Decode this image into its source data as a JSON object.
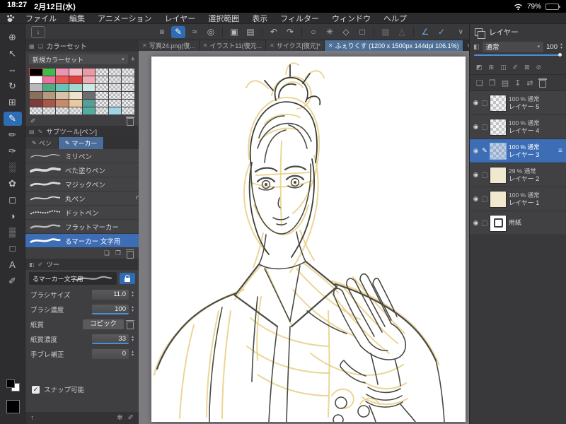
{
  "statusbar": {
    "time": "18:27",
    "date": "2月12日(水)",
    "battery": "79%"
  },
  "menubar": {
    "items": [
      "ファイル",
      "編集",
      "アニメーション",
      "レイヤー",
      "選択範囲",
      "表示",
      "フィルター",
      "ウィンドウ",
      "ヘルプ"
    ]
  },
  "toolbar": {
    "icons": [
      "≡",
      "✎",
      "≈",
      "◎",
      "▣",
      "▤",
      "↶",
      "↷",
      "○",
      "✳",
      "◇",
      "□",
      "▦",
      "△",
      "∠",
      "✓"
    ],
    "collapse": "∨",
    "panel_toggle": "↓"
  },
  "leftbar": {
    "icons": [
      "⊕",
      "↖",
      "⇔",
      "↻",
      "⊞",
      "✎",
      "✏",
      "✑",
      "░",
      "✿",
      "◻",
      "◑",
      "▒",
      "□",
      "A",
      "✐"
    ]
  },
  "tabs": {
    "close": "✕",
    "collapse": "∨",
    "items": [
      {
        "label": "写真24.png(復..."
      },
      {
        "label": "イラスト11(復元..."
      },
      {
        "label": "サイクス[復元]*"
      },
      {
        "label": "ふぇりくす (1200 x 1500px 144dpi 106.1%)"
      }
    ]
  },
  "colorset": {
    "title": "カラーセット",
    "header_icons": [
      "▦",
      "❏"
    ],
    "dropdown": "新規カラーセット",
    "dropdown_arrow": "▾",
    "add": "+",
    "edit": "✐",
    "selected_index": 0,
    "colors": [
      "#000000",
      "#3dbd4a",
      "#ef93b2",
      "#f6bcc6",
      "#eb9aa2",
      "",
      "",
      "",
      "#ffffff",
      "#ee6e9e",
      "#ea5a52",
      "#e33f3f",
      "#f2aab4",
      "",
      "",
      "",
      "#b9b9b9",
      "#4fae7e",
      "#66c4b8",
      "#9ed9cf",
      "#cdeae2",
      "",
      "",
      "",
      "#8a6f5c",
      "#b59a7e",
      "#d8c3a5",
      "#efe3cc",
      "#6d6d6f",
      "",
      "",
      "",
      "#7e3b3b",
      "#a85648",
      "#c98a6a",
      "#e8c9a0",
      "#579e96",
      "",
      "",
      "",
      "",
      "",
      "",
      "",
      "#4fae9e",
      "",
      "#9fd3e8",
      ""
    ]
  },
  "subtools": {
    "title": "サブツール[ペン]",
    "header_icons": [
      "▤",
      "✎"
    ],
    "tabs": [
      {
        "label": "ペン"
      },
      {
        "label": "マーカー"
      }
    ],
    "footer_icons": [
      "❏",
      "❐"
    ],
    "items": [
      {
        "name": "ミリペン"
      },
      {
        "name": "べた塗りペン"
      },
      {
        "name": "マジックペン"
      },
      {
        "name": "丸ペン"
      },
      {
        "name": "ドットペン"
      },
      {
        "name": "フラットマーカー"
      },
      {
        "name": "るマーカー 文字用"
      }
    ]
  },
  "toolprop": {
    "title": "ツー",
    "header_icons": [
      "◧",
      "✐"
    ],
    "tool_name": "るマーカー文字用",
    "props": [
      {
        "label": "ブラシサイズ",
        "value": "11.0"
      },
      {
        "label": "ブラシ濃度",
        "value": "100"
      },
      {
        "label": "紙質",
        "value": "コピック"
      },
      {
        "label": "紙質濃度",
        "value": "33"
      },
      {
        "label": "手ブレ補正",
        "value": "0"
      }
    ],
    "snap": {
      "label": "スナップ可能",
      "check": "✓"
    }
  },
  "bottombar": {
    "left": "↑",
    "right": [
      "✻",
      "✐"
    ]
  },
  "layers": {
    "title": "レイヤー",
    "blend_icon": "◧",
    "blend": "通常",
    "opacity": "100",
    "row_icons_a": [
      "◩",
      "⊞",
      "◫",
      "✐",
      "⊠",
      "⊘"
    ],
    "row_icons_b": [
      "❏",
      "❐",
      "▤",
      "↧",
      "⇄"
    ],
    "items": [
      {
        "opacity": "100 %",
        "blend": "通常",
        "name": "レイヤー 5"
      },
      {
        "opacity": "100 %",
        "blend": "通常",
        "name": "レイヤー 4"
      },
      {
        "opacity": "100 %",
        "blend": "通常",
        "name": "レイヤー 3"
      },
      {
        "opacity": "29 %",
        "blend": "通常",
        "name": "レイヤー 2"
      },
      {
        "opacity": "100 %",
        "blend": "通常",
        "name": "レイヤー 1"
      },
      {
        "name": "用紙"
      }
    ]
  },
  "glyphs": {
    "stepper_up": "▴",
    "stepper_down": "▾",
    "eye": "◉",
    "edit_pencil": "✎",
    "handle": "≡",
    "dropdown": "▾"
  },
  "colors": {
    "accent": "#2e6db4",
    "selection": "#3d6db5",
    "sketch_yellow": "#e7cf85",
    "line_dark": "#4a4a44"
  }
}
